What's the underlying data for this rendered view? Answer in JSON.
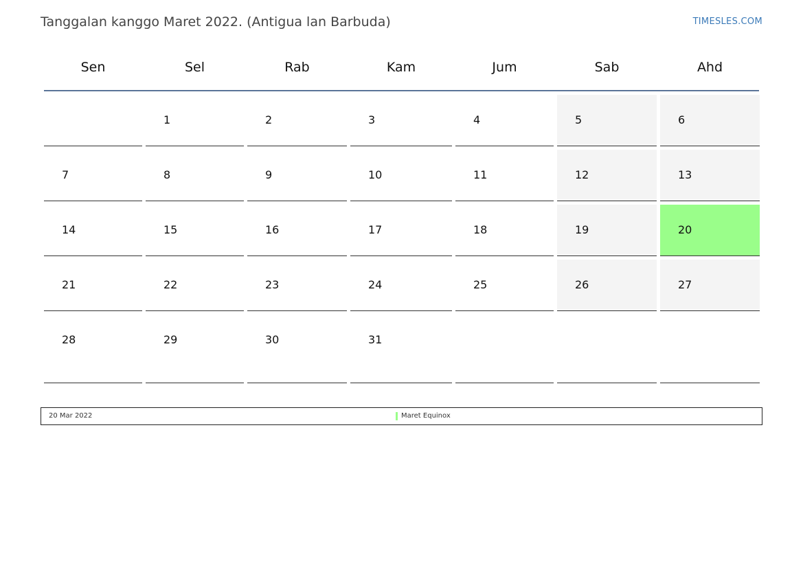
{
  "header": {
    "title": "Tanggalan kanggo Maret 2022. (Antigua lan Barbuda)",
    "brand": "TIMESLES.COM"
  },
  "weekdays": [
    "Sen",
    "Sel",
    "Rab",
    "Kam",
    "Jum",
    "Sab",
    "Ahd"
  ],
  "weeks": [
    [
      "",
      "1",
      "2",
      "3",
      "4",
      "5",
      "6"
    ],
    [
      "7",
      "8",
      "9",
      "10",
      "11",
      "12",
      "13"
    ],
    [
      "14",
      "15",
      "16",
      "17",
      "18",
      "19",
      "20"
    ],
    [
      "21",
      "22",
      "23",
      "24",
      "25",
      "26",
      "27"
    ],
    [
      "28",
      "29",
      "30",
      "31",
      "",
      "",
      ""
    ]
  ],
  "holidays": [
    {
      "date": "20 Mar 2022",
      "name": "Maret Equinox",
      "day": "20",
      "color": "#9afe8a"
    }
  ],
  "colors": {
    "accent_line": "#5a7498",
    "weekend": "#f4f4f4",
    "brand": "#3b7ab8"
  }
}
